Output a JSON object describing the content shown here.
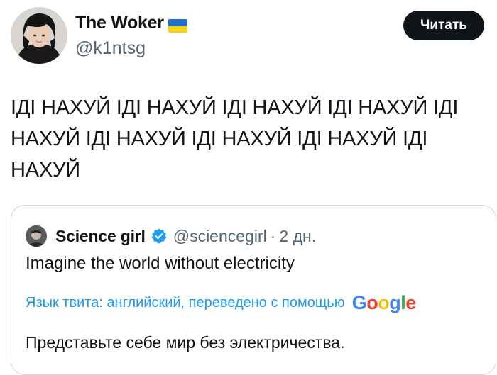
{
  "author": {
    "name": "The Woker",
    "handle": "@k1ntsg",
    "flag_icon": "ukraine-flag-icon"
  },
  "follow_button": {
    "label": "Читать"
  },
  "tweet": {
    "text": "ІДІ НАХУЙ ІДІ НАХУЙ ІДІ НАХУЙ ІДІ НАХУЙ ІДІ\nНАХУЙ ІДІ НАХУЙ ІДІ НАХУЙ ІДІ НАХУЙ ІДІ\nНАХУЙ"
  },
  "quoted_tweet": {
    "name": "Science girl",
    "verified_icon": "verified-badge-icon",
    "handle": "@sciencegirl",
    "separator": "·",
    "time": "2 дн.",
    "text": "Imagine the world without electricity",
    "translation_label": "Язык твита: английский, переведено с помощью",
    "translation_provider": "Google",
    "translated_text": "Представьте себе мир без электричества."
  },
  "colors": {
    "accent_blue": "#1d9bf0",
    "text_primary": "#0f1419",
    "text_secondary": "#536471",
    "button_bg": "#0f1419",
    "border": "#cfd9de",
    "google_blue": "#4285F4",
    "google_red": "#EA4335",
    "google_yellow": "#FBBC05",
    "google_green": "#34A853"
  }
}
